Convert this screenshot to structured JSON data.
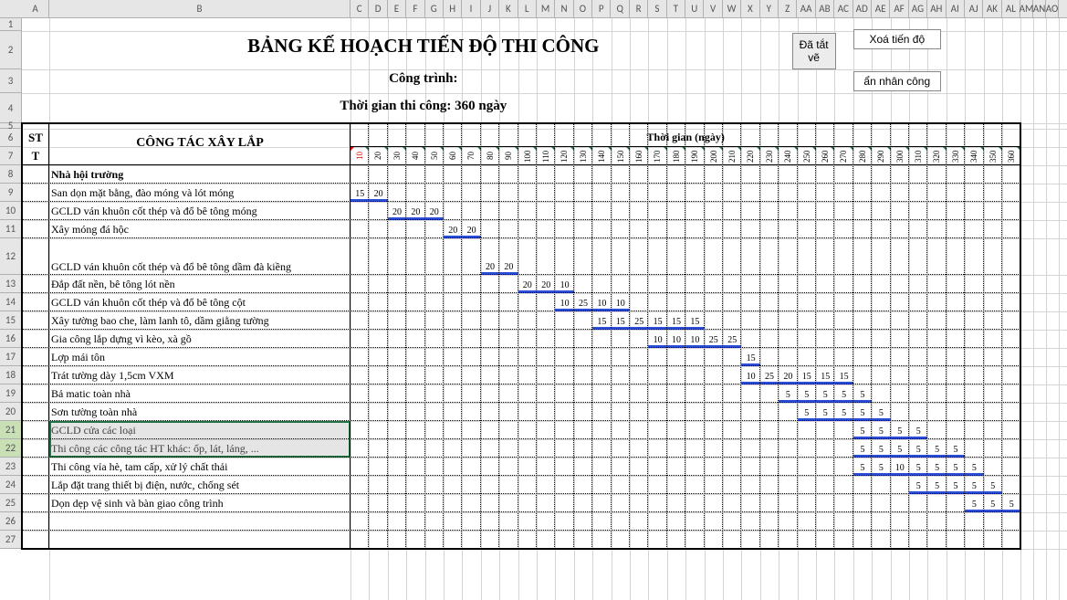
{
  "buttons": {
    "toggle_draw": "Đã tắt vẽ",
    "clear": "Xoá tiến độ",
    "hide_labor": "ẩn nhân công"
  },
  "title": "BẢNG KẾ HOẠCH TIẾN ĐỘ THI CÔNG",
  "project_label": "Công trình:",
  "duration_label": "Thời gian thi công: 360 ngày",
  "columns": {
    "st": "ST",
    "t": "T",
    "tasks": "CÔNG TÁC XÂY LẮP",
    "time": "Thời gian (ngày)"
  },
  "col_letters": [
    "A",
    "B",
    "C",
    "D",
    "E",
    "F",
    "G",
    "H",
    "I",
    "J",
    "K",
    "L",
    "M",
    "N",
    "O",
    "P",
    "Q",
    "R",
    "S",
    "T",
    "U",
    "V",
    "W",
    "X",
    "Y",
    "Z",
    "AA",
    "AB",
    "AC",
    "AD",
    "AE",
    "AF",
    "AG",
    "AH",
    "AI",
    "AJ",
    "AK",
    "AL",
    "AM",
    "AN",
    "AO"
  ],
  "day_labels": [
    "10",
    "20",
    "30",
    "40",
    "50",
    "60",
    "70",
    "80",
    "90",
    "100",
    "110",
    "120",
    "130",
    "140",
    "150",
    "160",
    "170",
    "180",
    "190",
    "200",
    "210",
    "220",
    "230",
    "240",
    "250",
    "260",
    "270",
    "280",
    "290",
    "300",
    "310",
    "320",
    "330",
    "340",
    "350",
    "360"
  ],
  "tasks": [
    {
      "r": 8,
      "label": "Nhà hội trường",
      "bold": true
    },
    {
      "r": 9,
      "label": "San dọn mặt bằng, đào móng và lót móng"
    },
    {
      "r": 10,
      "label": "GCLD ván khuôn cốt thép và đổ bê tông móng"
    },
    {
      "r": 11,
      "label": "Xây móng đá hộc"
    },
    {
      "r": 12,
      "label": "GCLD ván khuôn cốt thép và đổ bê tông dầm đà kiềng"
    },
    {
      "r": 13,
      "label": "Đắp đất nền, bê tông lót nền"
    },
    {
      "r": 14,
      "label": "GCLD ván khuôn cốt thép và đổ bê tông cột"
    },
    {
      "r": 15,
      "label": "Xây tường bao che, làm lanh tô, dầm giằng tường"
    },
    {
      "r": 16,
      "label": "Gia công lắp dựng vì kèo, xà gồ"
    },
    {
      "r": 17,
      "label": "Lợp mái tôn"
    },
    {
      "r": 18,
      "label": "Trát tường dày 1,5cm VXM"
    },
    {
      "r": 19,
      "label": "Bả matic toàn nhà"
    },
    {
      "r": 20,
      "label": "Sơn tường toàn nhà"
    },
    {
      "r": 21,
      "label": "GCLD cửa các loại"
    },
    {
      "r": 22,
      "label": "Thi công các công tác HT khác: ốp, lát, láng, ..."
    },
    {
      "r": 23,
      "label": "Thi công vỉa hè, tam cấp, xử lý chất thải"
    },
    {
      "r": 24,
      "label": "Lắp đặt trang thiết bị điện, nước, chống sét"
    },
    {
      "r": 25,
      "label": "Dọn dẹp vệ sinh và bàn giao công trình"
    }
  ],
  "bars": [
    {
      "r": 9,
      "s": 1,
      "v": [
        15,
        20
      ]
    },
    {
      "r": 10,
      "s": 3,
      "v": [
        20,
        20,
        20
      ]
    },
    {
      "r": 11,
      "s": 6,
      "v": [
        20,
        20
      ]
    },
    {
      "r": 12,
      "s": 8,
      "v": [
        20,
        20
      ]
    },
    {
      "r": 13,
      "s": 10,
      "v": [
        20,
        20,
        10
      ]
    },
    {
      "r": 14,
      "s": 12,
      "v": [
        10,
        25,
        10,
        10
      ]
    },
    {
      "r": 15,
      "s": 14,
      "v": [
        15,
        15,
        25,
        15,
        15,
        15
      ]
    },
    {
      "r": 16,
      "s": 17,
      "v": [
        10,
        10,
        10,
        25,
        25
      ]
    },
    {
      "r": 17,
      "s": 22,
      "v": [
        15
      ]
    },
    {
      "r": 18,
      "s": 22,
      "v": [
        10,
        25,
        20,
        15,
        15,
        15
      ]
    },
    {
      "r": 19,
      "s": 24,
      "v": [
        5,
        5,
        5,
        5,
        5
      ]
    },
    {
      "r": 20,
      "s": 25,
      "v": [
        5,
        5,
        5,
        5,
        5
      ]
    },
    {
      "r": 21,
      "s": 28,
      "v": [
        5,
        5,
        5,
        5
      ]
    },
    {
      "r": 22,
      "s": 28,
      "v": [
        5,
        5,
        5,
        5,
        5,
        5
      ]
    },
    {
      "r": 23,
      "s": 28,
      "v": [
        5,
        5,
        10,
        5,
        5,
        5,
        5
      ]
    },
    {
      "r": 24,
      "s": 31,
      "v": [
        5,
        5,
        5,
        5,
        5
      ]
    },
    {
      "r": 25,
      "s": 34,
      "v": [
        5,
        5,
        5
      ]
    }
  ],
  "heights": {
    "1": 14,
    "2": 42,
    "3": 26,
    "4": 33,
    "5": 6,
    "6": 20,
    "7": 20,
    "8": 20,
    "9": 20,
    "10": 20,
    "11": 20,
    "12": 40,
    "13": 20,
    "14": 20,
    "15": 20,
    "16": 20,
    "17": 20,
    "18": 20,
    "19": 20,
    "20": 20,
    "21": 20,
    "22": 20,
    "23": 20,
    "24": 20,
    "25": 20,
    "26": 20,
    "27": 20
  },
  "selected_rows": [
    21,
    22
  ]
}
